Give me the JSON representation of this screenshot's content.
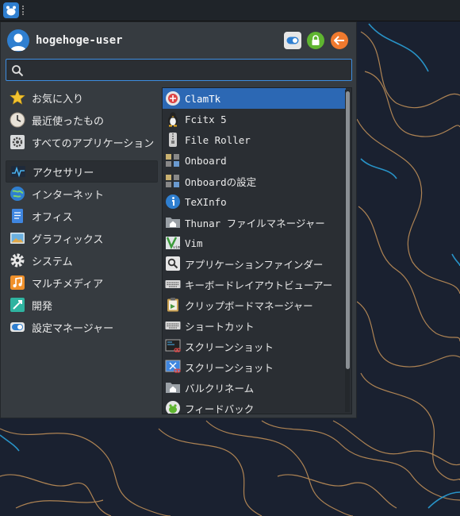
{
  "user": {
    "name": "hogehoge-user"
  },
  "search": {
    "value": "",
    "placeholder": ""
  },
  "header_buttons": [
    {
      "icon": "settings-toggle-icon"
    },
    {
      "icon": "lock-icon"
    },
    {
      "icon": "logout-icon"
    }
  ],
  "categories": {
    "top": [
      {
        "label": "お気に入り",
        "icon": "star-icon"
      },
      {
        "label": "最近使ったもの",
        "icon": "clock-icon"
      },
      {
        "label": "すべてのアプリケーション",
        "icon": "gear-icon"
      }
    ],
    "main": [
      {
        "label": "アクセサリー",
        "icon": "accessories-icon",
        "active": true
      },
      {
        "label": "インターネット",
        "icon": "globe-icon"
      },
      {
        "label": "オフィス",
        "icon": "office-icon"
      },
      {
        "label": "グラフィックス",
        "icon": "graphics-icon"
      },
      {
        "label": "システム",
        "icon": "system-gear-icon"
      },
      {
        "label": "マルチメディア",
        "icon": "multimedia-icon"
      },
      {
        "label": "開発",
        "icon": "development-icon"
      },
      {
        "label": "設定マネージャー",
        "icon": "settings-manager-icon"
      }
    ]
  },
  "apps": [
    {
      "label": "ClamTk",
      "icon": "clamtk-icon",
      "selected": true
    },
    {
      "label": "Fcitx 5",
      "icon": "tux-icon"
    },
    {
      "label": "File Roller",
      "icon": "archive-icon"
    },
    {
      "label": "Onboard",
      "icon": "onboard-icon"
    },
    {
      "label": "Onboardの設定",
      "icon": "onboard-settings-icon"
    },
    {
      "label": "TeXInfo",
      "icon": "info-icon"
    },
    {
      "label": "Thunar ファイルマネージャー",
      "icon": "home-folder-icon"
    },
    {
      "label": "Vim",
      "icon": "vim-icon"
    },
    {
      "label": "アプリケーションファインダー",
      "icon": "app-finder-icon"
    },
    {
      "label": "キーボードレイアウトビューアー",
      "icon": "keyboard-icon"
    },
    {
      "label": "クリップボードマネージャー",
      "icon": "clipboard-icon"
    },
    {
      "label": "ショートカット",
      "icon": "keyboard-shortcut-icon"
    },
    {
      "label": "スクリーンショット",
      "icon": "screenshot-icon"
    },
    {
      "label": "スクリーンショット",
      "icon": "screenshot-alt-icon"
    },
    {
      "label": "バルクリネーム",
      "icon": "bulk-rename-icon"
    },
    {
      "label": "フィードバック",
      "icon": "feedback-icon"
    }
  ],
  "colors": {
    "accent": "#2c68b4",
    "panel_bg": "#363b40",
    "list_bg": "#2a2e33",
    "wallpaper": "#1a2130",
    "contour_orange": "#c8955a",
    "contour_blue": "#2aa0d8"
  }
}
